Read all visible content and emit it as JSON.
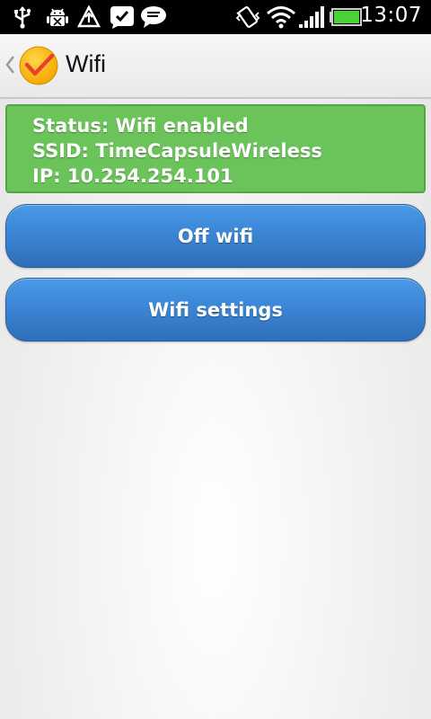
{
  "status_bar": {
    "time": "13:07",
    "icons": [
      "usb-icon",
      "android-debug-icon",
      "upload-warning-icon",
      "check-notification-icon",
      "message-icon",
      "vibrate-icon",
      "wifi-icon",
      "signal-icon",
      "battery-icon"
    ]
  },
  "action_bar": {
    "title": "Wifi",
    "app_icon": "checkmark-app-icon"
  },
  "status_panel": {
    "status": "Status: Wifi enabled",
    "ssid": "SSID: TimeCapsuleWireless",
    "ip": "IP: 10.254.254.101",
    "color": "#6bc45a"
  },
  "buttons": {
    "off_wifi": "Off wifi",
    "wifi_settings": "Wifi settings",
    "color": "#3b86d6"
  }
}
